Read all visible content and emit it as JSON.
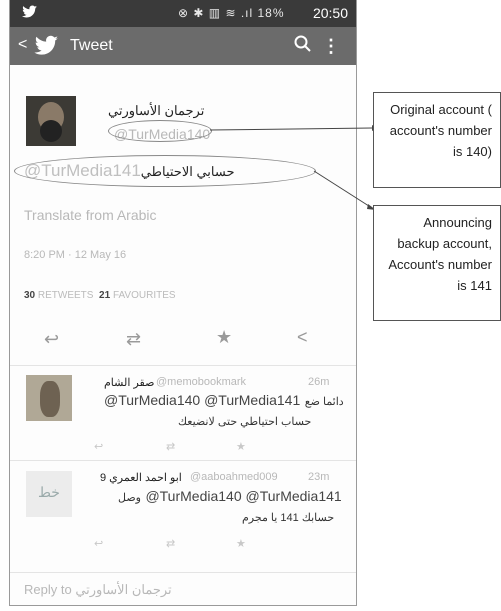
{
  "status_bar": {
    "icons": "⊗ ✱ ▥ ≋ .ıl 18%",
    "time": "20:50"
  },
  "app_bar": {
    "title": "Tweet"
  },
  "tweet": {
    "display_name": "ترجمان الأساورتي",
    "handle": "@TurMedia140",
    "text_handle": "@TurMedia141",
    "text_arabic": "حسابي الاحتياطي",
    "translate": "Translate from Arabic",
    "timestamp": "8:20 PM · 12 May 16",
    "retweets_count": "30",
    "retweets_label": "RETWEETS",
    "favourites_count": "21",
    "favourites_label": "FAVOURITES"
  },
  "replies": [
    {
      "name": "صقر الشام",
      "handle": "@memobookmark",
      "time": "26m",
      "line1_handles": "@TurMedia140 @TurMedia141",
      "line1_arabic": "دائما ضع",
      "line2": "حساب احتياطي حتى لانضيعك"
    },
    {
      "name": "ابو احمد العمري 9",
      "handle": "@aaboahmed009",
      "time": "23m",
      "line1_handles": "@TurMedia140 @TurMedia141",
      "line1_arabic": "وصل",
      "line2": "حسابك 141 يا مجرم"
    }
  ],
  "reply_bar": {
    "placeholder": "Reply to ترجمان الأساورتي"
  },
  "annotations": {
    "original": [
      "Original account (",
      "account's number",
      "is 140)"
    ],
    "backup": [
      "Announcing",
      "backup account,",
      "Account's number",
      "is 141"
    ]
  }
}
